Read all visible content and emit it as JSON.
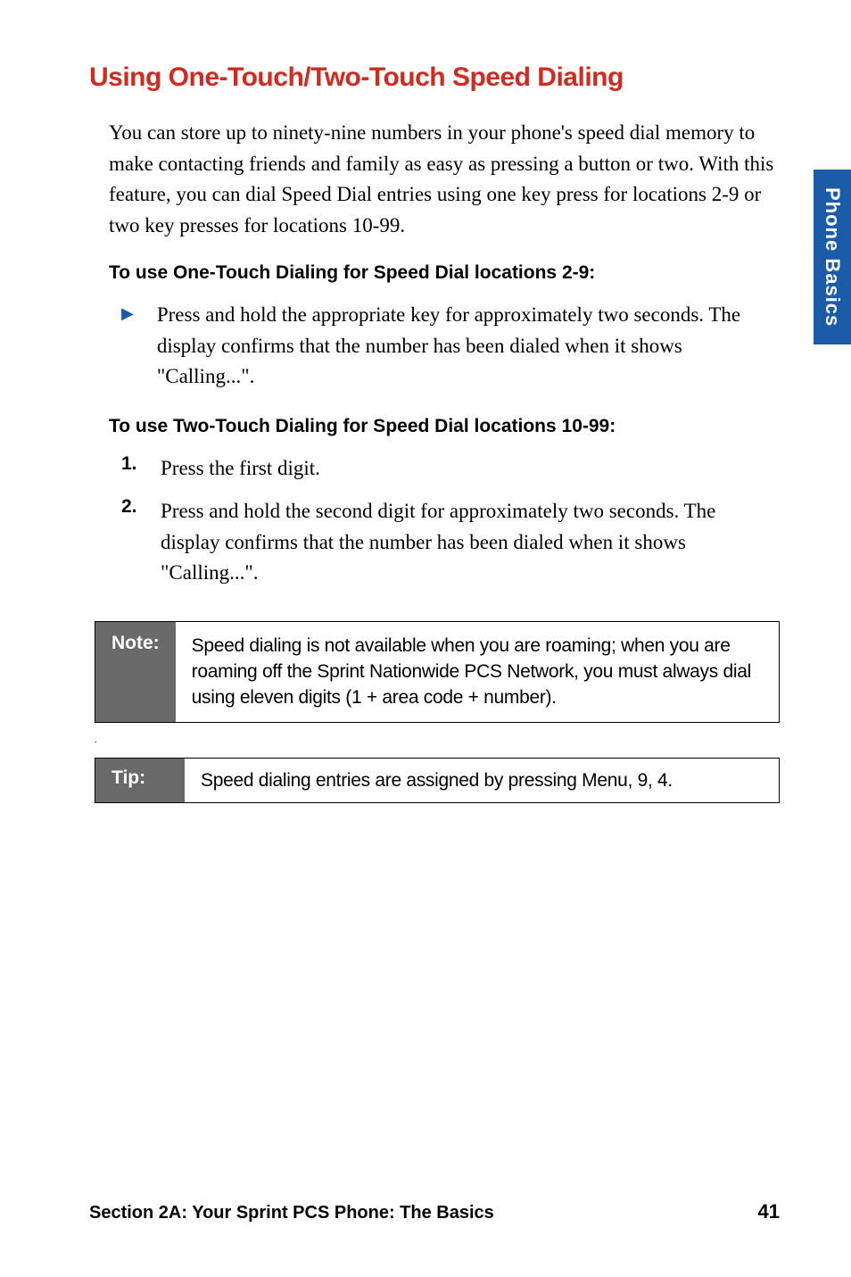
{
  "sideTab": "Phone Basics",
  "heading": "Using One-Touch/Two-Touch Speed Dialing",
  "intro": "You can store up to ninety-nine numbers in your phone's speed dial memory to make contacting friends and family as easy as pressing a button or two. With this feature, you can dial Speed Dial entries using one key press for locations 2-9 or two key presses for locations 10-99.",
  "subheading1": "To use One-Touch Dialing for Speed Dial locations 2-9:",
  "bullet1": "Press and hold the appropriate key for approximately two seconds. The display confirms that the number has been dialed when it shows \"Calling...\".",
  "subheading2": "To use Two-Touch Dialing for Speed Dial locations 10-99:",
  "step1_num": "1.",
  "step1_text": "Press the first digit.",
  "step2_num": "2.",
  "step2_text": "Press and hold the second digit for approximately two seconds. The display confirms that the number has been dialed when it shows \"Calling...\".",
  "note_label": "Note:",
  "note_content": "Speed dialing is not available when you are roaming; when you are roaming off the Sprint Nationwide PCS Network, you must always dial using eleven digits (1 + area code + number).",
  "tip_label": "Tip:",
  "tip_content": "Speed dialing entries are assigned by pressing Menu, 9, 4.",
  "footer_text": "Section 2A: Your Sprint PCS Phone: The Basics",
  "footer_page": "41",
  "dot": "."
}
